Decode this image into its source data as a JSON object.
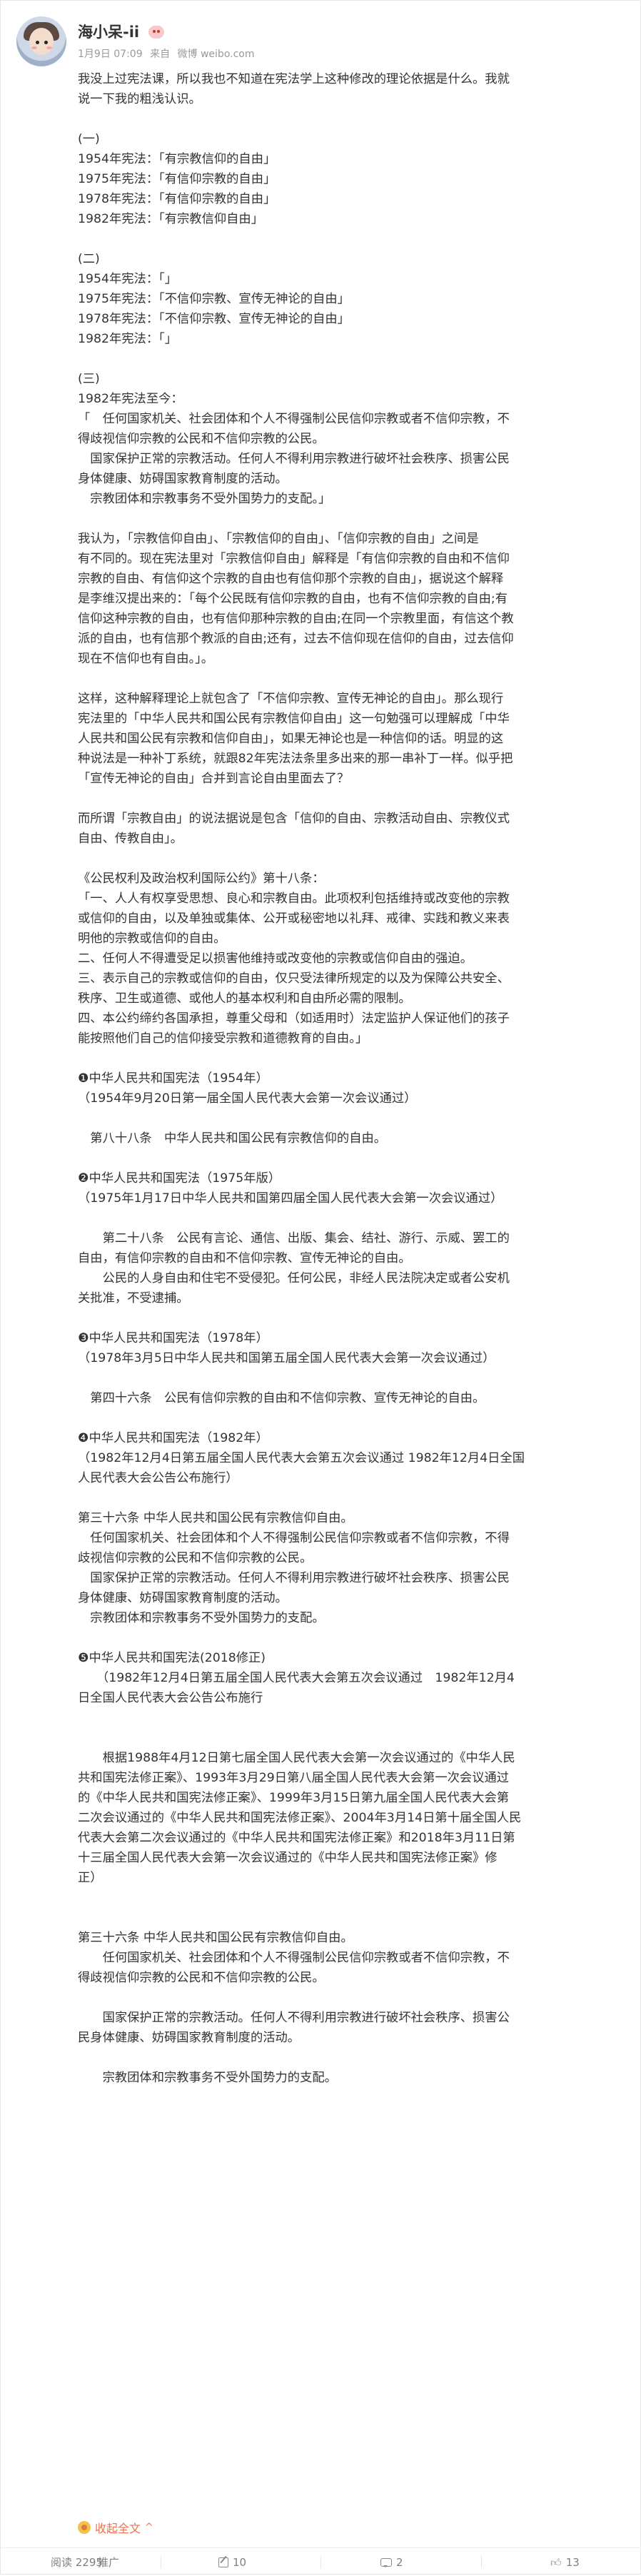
{
  "user": {
    "name": "海小呆-ii",
    "badge_icon": "cute-face-emoji-icon"
  },
  "meta": {
    "time": "1月9日 07:09",
    "source_prefix": "来自",
    "source": "微博 weibo.com"
  },
  "post": {
    "lines": [
      "我没上过宪法课，所以我也不知道在宪法学上这种修改的理论依据是什么。我就",
      "说一下我的粗浅认识。",
      "",
      "(一)",
      "1954年宪法：「有宗教信仰的自由」",
      "1975年宪法：「有信仰宗教的自由」",
      "1978年宪法：「有信仰宗教的自由」",
      "1982年宪法：「有宗教信仰自由」",
      "",
      "(二)",
      "1954年宪法：「」",
      "1975年宪法：「不信仰宗教、宣传无神论的自由」",
      "1978年宪法：「不信仰宗教、宣传无神论的自由」",
      "1982年宪法：「」",
      "",
      "(三)",
      "1982年宪法至今：",
      "「　任何国家机关、社会团体和个人不得强制公民信仰宗教或者不信仰宗教，不",
      "得歧视信仰宗教的公民和不信仰宗教的公民。",
      "　国家保护正常的宗教活动。任何人不得利用宗教进行破坏社会秩序、损害公民",
      "身体健康、妨碍国家教育制度的活动。",
      "　宗教团体和宗教事务不受外国势力的支配。」",
      "",
      "我认为，「宗教信仰自由」、「宗教信仰的自由」、「信仰宗教的自由」之间是",
      "有不同的。现在宪法里对「宗教信仰自由」解释是「有信仰宗教的自由和不信仰",
      "宗教的自由、有信仰这个宗教的自由也有信仰那个宗教的自由」，据说这个解释",
      "是李维汉提出来的：「每个公民既有信仰宗教的自由，也有不信仰宗教的自由;有",
      "信仰这种宗教的自由，也有信仰那种宗教的自由;在同一个宗教里面，有信这个教",
      "派的自由，也有信那个教派的自由;还有，过去不信仰现在信仰的自由，过去信仰",
      "现在不信仰也有自由。」。",
      "",
      "这样，这种解释理论上就包含了「不信仰宗教、宣传无神论的自由」。那么现行",
      "宪法里的「中华人民共和国公民有宗教信仰自由」这一句勉强可以理解成「中华",
      "人民共和国公民有宗教和信仰自由」，如果无神论也是一种信仰的话。明显的这",
      "种说法是一种补丁系统，就跟82年宪法法条里多出来的那一串补丁一样。似乎把",
      "「宣传无神论的自由」合并到言论自由里面去了？",
      "",
      "而所谓「宗教自由」的说法据说是包含「信仰的自由、宗教活动自由、宗教仪式",
      "自由、传教自由」。",
      "",
      "《公民权利及政治权利国际公约》第十八条：",
      "「一、人人有权享受思想、良心和宗教自由。此项权利包括维持或改变他的宗教",
      "或信仰的自由，以及单独或集体、公开或秘密地以礼拜、戒律、实践和教义来表",
      "明他的宗教或信仰的自由。",
      "二、任何人不得遭受足以损害他维持或改变他的宗教或信仰自由的强迫。",
      "三、表示自己的宗教或信仰的自由，仅只受法律所规定的以及为保障公共安全、",
      "秩序、卫生或道德、或他人的基本权利和自由所必需的限制。",
      "四、本公约缔约各国承担，尊重父母和（如适用时）法定监护人保证他们的孩子",
      "能按照他们自己的信仰接受宗教和道德教育的自由。」",
      "",
      "❶中华人民共和国宪法（1954年）",
      "（1954年9月20日第一届全国人民代表大会第一次会议通过）",
      "",
      "　第八十八条　中华人民共和国公民有宗教信仰的自由。",
      "",
      "❷中华人民共和国宪法（1975年版）",
      "（1975年1月17日中华人民共和国第四届全国人民代表大会第一次会议通过）",
      "",
      "　　第二十八条　公民有言论、通信、出版、集会、结社、游行、示威、罢工的",
      "自由，有信仰宗教的自由和不信仰宗教、宣传无神论的自由。",
      "　　公民的人身自由和住宅不受侵犯。任何公民，非经人民法院决定或者公安机",
      "关批准，不受逮捕。",
      "",
      "❸中华人民共和国宪法（1978年）",
      "（1978年3月5日中华人民共和国第五届全国人民代表大会第一次会议通过）",
      "",
      "　第四十六条　公民有信仰宗教的自由和不信仰宗教、宣传无神论的自由。",
      "",
      "❹中华人民共和国宪法（1982年）",
      "（1982年12月4日第五届全国人民代表大会第五次会议通过 1982年12月4日全国",
      "人民代表大会公告公布施行）",
      "",
      "第三十六条 中华人民共和国公民有宗教信仰自由。",
      "　任何国家机关、社会团体和个人不得强制公民信仰宗教或者不信仰宗教，不得",
      "歧视信仰宗教的公民和不信仰宗教的公民。",
      "　国家保护正常的宗教活动。任何人不得利用宗教进行破坏社会秩序、损害公民",
      "身体健康、妨碍国家教育制度的活动。",
      "　宗教团体和宗教事务不受外国势力的支配。",
      "",
      "❺中华人民共和国宪法(2018修正)",
      "　　（1982年12月4日第五届全国人民代表大会第五次会议通过　1982年12月4",
      "日全国人民代表大会公告公布施行",
      "",
      "",
      "　　根据1988年4月12日第七届全国人民代表大会第一次会议通过的《中华人民",
      "共和国宪法修正案》、1993年3月29日第八届全国人民代表大会第一次会议通过",
      "的《中华人民共和国宪法修正案》、1999年3月15日第九届全国人民代表大会第",
      "二次会议通过的《中华人民共和国宪法修正案》、2004年3月14日第十届全国人民",
      "代表大会第二次会议通过的《中华人民共和国宪法修正案》和2018年3月11日第",
      "十三届全国人民代表大会第一次会议通过的《中华人民共和国宪法修正案》修",
      "正）",
      "",
      "",
      "第三十六条 中华人民共和国公民有宗教信仰自由。",
      "　　任何国家机关、社会团体和个人不得强制公民信仰宗教或者不信仰宗教，不",
      "得歧视信仰宗教的公民和不信仰宗教的公民。",
      "",
      "　　国家保护正常的宗教活动。任何人不得利用宗教进行破坏社会秩序、损害公",
      "民身体健康、妨碍国家教育制度的活动。",
      "",
      "　　宗教团体和宗教事务不受外国势力的支配。"
    ],
    "collapse_label": "收起全文",
    "collapse_icon": "emoji-face-icon",
    "collapse_chevron": "^"
  },
  "actions": {
    "read": "阅读 2295",
    "promote": "推广",
    "share_count": "10",
    "comment_count": "2",
    "like_count": "13"
  },
  "colors": {
    "accent": "#eb7350",
    "text": "#333333",
    "muted": "#999999"
  }
}
